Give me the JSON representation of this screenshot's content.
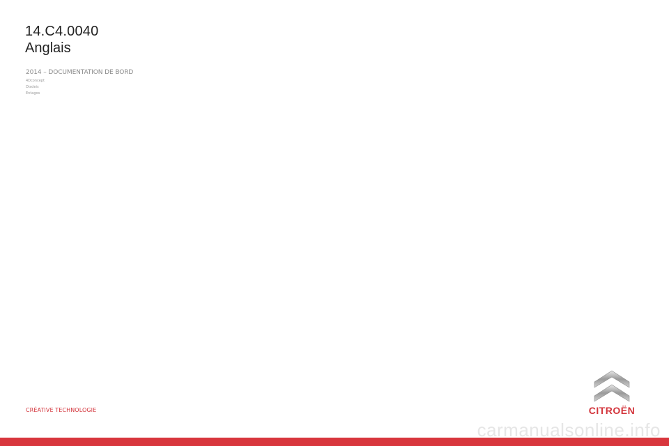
{
  "document": {
    "code": "14.C4.0040",
    "language": "Anglais",
    "header": "2014 – DOCUMENTATION DE BORD",
    "credits": [
      "4Dconcept",
      "Diadeis",
      "Entagos"
    ],
    "tagline": "CRÉATIVE TECHNOLOGIE"
  },
  "brand": {
    "name": "CITROËN",
    "logo_icon": "double-chevron-icon"
  },
  "watermark": "carmanualsonline.info",
  "colors": {
    "accent": "#d3353c",
    "band": "#d8363d",
    "text": "#222222",
    "muted": "#8a8a8a"
  }
}
